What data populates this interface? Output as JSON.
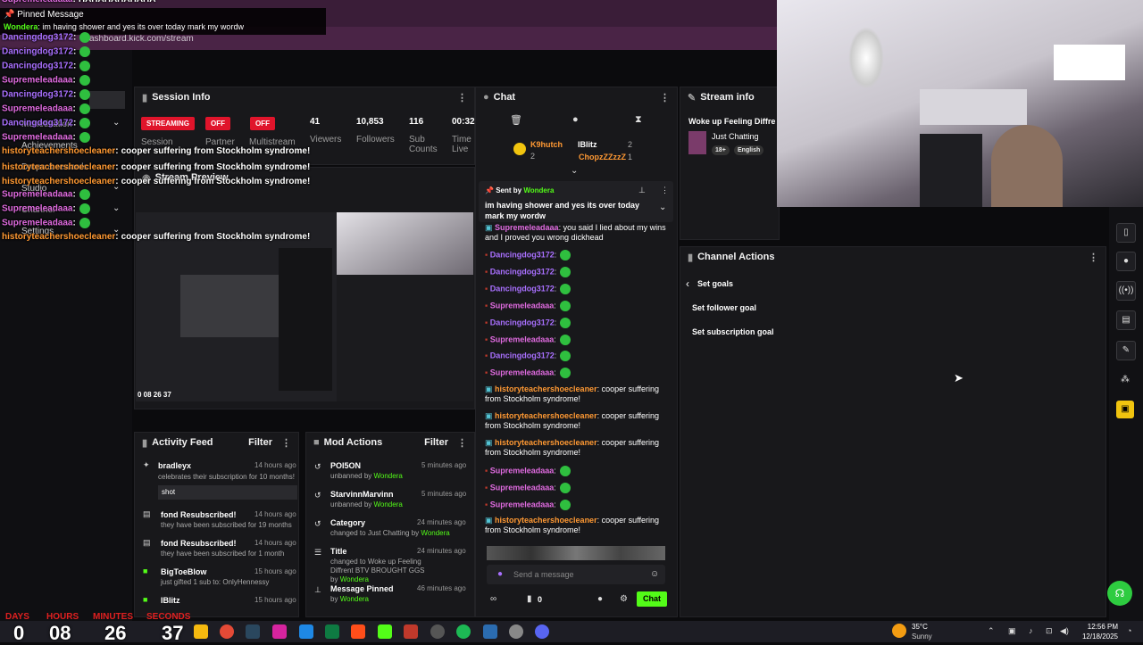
{
  "browser": {
    "url_fragment": "ashboard.kick.com/stream"
  },
  "pinned_banner": {
    "title": "Pinned Message",
    "user": "Wondera",
    "text": "im having shower and yes its over today mark my wordw"
  },
  "overlay_chat": [
    {
      "user": "Supremeleadaaa",
      "text": "HAHAHAHAHAHA",
      "color": "#e06be0"
    },
    {
      "user": "Dancingdog3172",
      "text": "",
      "color": "#a970ff"
    },
    {
      "user": "Dancingdog3172",
      "text": "",
      "color": "#a970ff"
    },
    {
      "user": "Dancingdog3172",
      "text": "",
      "color": "#a970ff"
    },
    {
      "user": "Supremeleadaaa",
      "text": "",
      "color": "#e06be0"
    },
    {
      "user": "Dancingdog3172",
      "text": "",
      "color": "#a970ff"
    },
    {
      "user": "Supremeleadaaa",
      "text": "",
      "color": "#e06be0"
    },
    {
      "user": "Dancingdog3172",
      "text": "",
      "color": "#a970ff"
    },
    {
      "user": "Supremeleadaaa",
      "text": "",
      "color": "#e06be0"
    },
    {
      "user": "historyteachershoecleaner",
      "text": "cooper suffering from Stockholm syndrome!",
      "color": "#ff9933"
    },
    {
      "user": "historyteachershoecleaner",
      "text": "cooper suffering from Stockholm syndrome!",
      "color": "#ff9933"
    },
    {
      "user": "historyteachershoecleaner",
      "text": "cooper suffering from Stockholm syndrome!",
      "color": "#ff9933"
    },
    {
      "user": "Supremeleadaaa",
      "text": "",
      "color": "#e06be0"
    },
    {
      "user": "Supremeleadaaa",
      "text": "",
      "color": "#e06be0"
    },
    {
      "user": "Supremeleadaaa",
      "text": "",
      "color": "#e06be0"
    },
    {
      "user": "historyteachershoecleaner",
      "text": "cooper suffering from Stockholm syndrome!",
      "color": "#ff9933"
    }
  ],
  "nav": {
    "items": [
      "Achievements",
      "Drops & rewards",
      "Studio",
      "Channel",
      "Settings"
    ],
    "monetization": "Monetization"
  },
  "session_info": {
    "title": "Session Info",
    "badges": [
      {
        "state": "STREAMING",
        "label": "Session"
      },
      {
        "state": "OFF",
        "label": "Partner"
      },
      {
        "state": "OFF",
        "label": "Multistream"
      }
    ],
    "stats": [
      {
        "value": "41",
        "label": "Viewers"
      },
      {
        "value": "10,853",
        "label": "Followers"
      },
      {
        "value": "116",
        "label": "Sub Counts"
      },
      {
        "value": "00:32",
        "label": "Time Live"
      }
    ]
  },
  "stream_preview": {
    "title": "Stream Preview",
    "timer": "0 08 26 37"
  },
  "chat": {
    "title": "Chat",
    "leaderboard": [
      {
        "user": "K9hutch",
        "count": "2"
      },
      {
        "user": "IBlitz",
        "count": "2"
      },
      {
        "user": "ChopzZZzzZ",
        "count": "1"
      }
    ],
    "pinned": {
      "sent_by_label": "Sent by",
      "user": "Wondera",
      "text": "im having shower and yes its over today mark my wordw"
    },
    "messages": [
      {
        "user": "Supremeleadaaa",
        "text": "you said I lied about my wins and I proved you wrong dickhead",
        "color": "#e06be0",
        "emote": false
      },
      {
        "user": "Dancingdog3172",
        "text": ":",
        "color": "#a970ff",
        "emote": true
      },
      {
        "user": "Dancingdog3172",
        "text": ":",
        "color": "#a970ff",
        "emote": true
      },
      {
        "user": "Dancingdog3172",
        "text": ":",
        "color": "#a970ff",
        "emote": true
      },
      {
        "user": "Supremeleadaaa",
        "text": ":",
        "color": "#e06be0",
        "emote": true
      },
      {
        "user": "Dancingdog3172",
        "text": ":",
        "color": "#a970ff",
        "emote": true
      },
      {
        "user": "Supremeleadaaa",
        "text": ":",
        "color": "#e06be0",
        "emote": true
      },
      {
        "user": "Dancingdog3172",
        "text": ":",
        "color": "#a970ff",
        "emote": true
      },
      {
        "user": "Supremeleadaaa",
        "text": ":",
        "color": "#e06be0",
        "emote": true
      },
      {
        "user": "historyteachershoecleaner",
        "text": "cooper suffering from Stockholm syndrome!",
        "color": "#ff9933",
        "emote": false
      },
      {
        "user": "historyteachershoecleaner",
        "text": "cooper suffering from Stockholm syndrome!",
        "color": "#ff9933",
        "emote": false
      },
      {
        "user": "historyteachershoecleaner",
        "text": "cooper suffering from Stockholm syndrome!",
        "color": "#ff9933",
        "emote": false
      },
      {
        "user": "Supremeleadaaa",
        "text": ":",
        "color": "#e06be0",
        "emote": true
      },
      {
        "user": "Supremeleadaaa",
        "text": ":",
        "color": "#e06be0",
        "emote": true
      },
      {
        "user": "Supremeleadaaa",
        "text": ":",
        "color": "#e06be0",
        "emote": true
      },
      {
        "user": "historyteachershoecleaner",
        "text": "cooper suffering from Stockholm syndrome!",
        "color": "#ff9933",
        "emote": false
      }
    ],
    "input_placeholder": "Send a message",
    "points": "0",
    "send_label": "Chat"
  },
  "stream_info": {
    "title": "Stream info",
    "stream_title": "Woke up Feeling Diffrent",
    "category": "Just Chatting",
    "tags": [
      "18+",
      "English"
    ]
  },
  "channel_actions": {
    "title": "Channel Actions",
    "back_label": "Set goals",
    "items": [
      "Set follower goal",
      "Set subscription goal"
    ]
  },
  "activity_feed": {
    "title": "Activity Feed",
    "filter_label": "Filter",
    "items": [
      {
        "user": "bradleyx",
        "desc": "celebrates their subscription for 10 months!",
        "time": "14 hours ago",
        "message": "shot"
      },
      {
        "user": "fond Resubscribed!",
        "desc": "they have been subscribed for 19 months",
        "time": "14 hours ago",
        "message": ""
      },
      {
        "user": "fond Resubscribed!",
        "desc": "they have been subscribed for 1 month",
        "time": "14 hours ago",
        "message": ""
      },
      {
        "user": "BigToeBlow",
        "desc": "just gifted 1 sub to: OnlyHennessy",
        "time": "15 hours ago",
        "message": ""
      },
      {
        "user": "IBlitz",
        "desc": "",
        "time": "15 hours ago",
        "message": ""
      }
    ]
  },
  "mod_actions": {
    "title": "Mod Actions",
    "filter_label": "Filter",
    "items": [
      {
        "title": "POI5ON",
        "desc": "unbanned by",
        "by": "Wondera",
        "time": "5 minutes ago"
      },
      {
        "title": "StarvinnMarvinn",
        "desc": "unbanned by",
        "by": "Wondera",
        "time": "5 minutes ago"
      },
      {
        "title": "Category",
        "desc": "changed to Just Chatting by",
        "by": "Wondera",
        "time": "24 minutes ago"
      },
      {
        "title": "Title",
        "desc": "changed to Woke up Feeling Diffrent BTV BROUGHT GGS by",
        "by": "Wondera",
        "time": "24 minutes ago"
      },
      {
        "title": "Message Pinned",
        "desc": "by",
        "by": "Wondera",
        "time": "46 minutes ago"
      }
    ]
  },
  "counter": {
    "labels": [
      "DAYS",
      "HOURS",
      "MINUTES",
      "SECONDS"
    ],
    "values": [
      "0",
      "08",
      "26",
      "37"
    ]
  },
  "taskbar": {
    "weather_temp": "35°C",
    "weather_desc": "Sunny",
    "time": "12:56 PM",
    "date": "12/18/2025"
  }
}
